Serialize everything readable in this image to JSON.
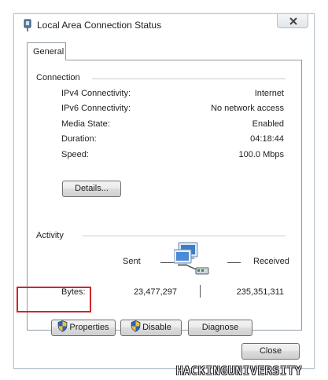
{
  "window": {
    "title": "Local Area Connection Status",
    "icon": "network-adapter-icon",
    "close_icon": "close-icon"
  },
  "tabs": [
    {
      "label": "General",
      "selected": true
    }
  ],
  "connection": {
    "heading": "Connection",
    "rows": [
      {
        "label": "IPv4 Connectivity:",
        "value": "Internet"
      },
      {
        "label": "IPv6 Connectivity:",
        "value": "No network access"
      },
      {
        "label": "Media State:",
        "value": "Enabled"
      },
      {
        "label": "Duration:",
        "value": "04:18:44"
      },
      {
        "label": "Speed:",
        "value": "100.0 Mbps"
      }
    ],
    "details_button": "Details..."
  },
  "activity": {
    "heading": "Activity",
    "sent_label": "Sent",
    "received_label": "Received",
    "bytes_label": "Bytes:",
    "bytes_sent": "23,477,297",
    "bytes_received": "235,351,311",
    "icon": "network-computers-icon"
  },
  "actions": {
    "properties": "Properties",
    "disable": "Disable",
    "diagnose": "Diagnose",
    "shield_icon": "uac-shield-icon"
  },
  "footer": {
    "close": "Close"
  },
  "watermark": "HACKINGUNIVERSITY",
  "colors": {
    "highlight": "#d0262b",
    "border": "#8e9aa7"
  }
}
